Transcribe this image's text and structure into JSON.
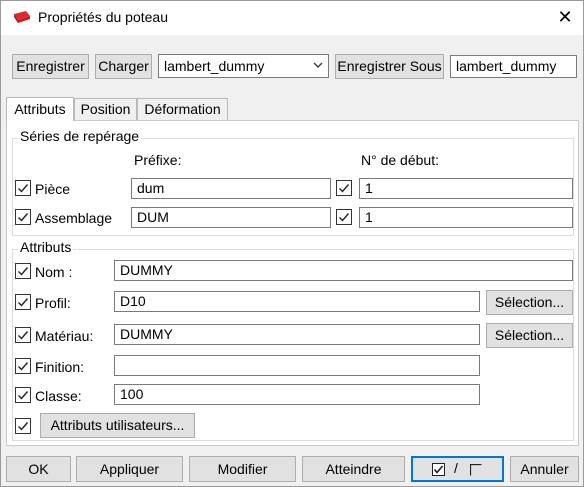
{
  "window": {
    "title": "Propriétés du poteau",
    "icon": "red-component-icon",
    "close_glyph": "✕"
  },
  "toolbar": {
    "save_label": "Enregistrer",
    "load_label": "Charger",
    "preset_select_value": "lambert_dummy",
    "save_as_label": "Enregistrer Sous",
    "save_as_name_value": "lambert_dummy"
  },
  "tabs": [
    {
      "label": "Attributs",
      "active": true
    },
    {
      "label": "Position",
      "active": false
    },
    {
      "label": "Déformation",
      "active": false
    }
  ],
  "numbering": {
    "group_title": "Séries de repérage",
    "prefix_header": "Préfixe:",
    "start_header": "N° de début:",
    "rows": [
      {
        "label": "Pièce",
        "prefix": "dum",
        "start": "1"
      },
      {
        "label": "Assemblage",
        "prefix": "DUM",
        "start": "1"
      }
    ]
  },
  "attributes": {
    "group_title": "Attributs",
    "name_label": "Nom :",
    "name_value": "DUMMY",
    "profile_label": "Profil:",
    "profile_value": "D10",
    "material_label": "Matériau:",
    "material_value": "DUMMY",
    "finish_label": "Finition:",
    "finish_value": "",
    "class_label": "Classe:",
    "class_value": "100",
    "select_label": "Sélection...",
    "user_attrs_label": "Attributs utilisateurs..."
  },
  "footer": {
    "ok_label": "OK",
    "apply_label": "Appliquer",
    "modify_label": "Modifier",
    "get_label": "Atteindre",
    "toggle_slash": "/",
    "cancel_label": "Annuler"
  },
  "colors": {
    "accent": "#0078d7",
    "icon_red": "#d42020"
  }
}
